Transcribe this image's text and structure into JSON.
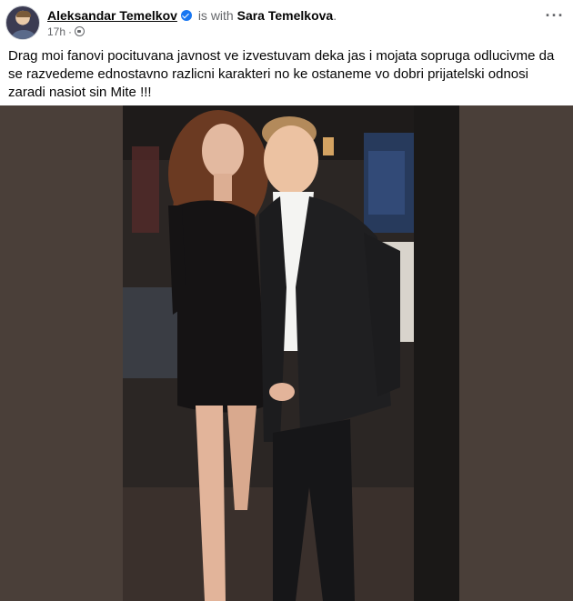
{
  "post": {
    "author": "Aleksandar Temelkov",
    "is_with": "is with",
    "tagged_user": "Sara Temelkova",
    "period": ".",
    "time": "17h",
    "dot": "·",
    "more_label": "···",
    "text": "Drag moi fanovi pocituvana javnost ve izvestuvam deka jas i mojata sopruga odlucivme da se razvedeme ednostavno razlicni karakteri no ke ostaneme vo dobri prijatelski odnosi  zaradi nasiot sin Mite !!!",
    "icons": [
      "verified-badge-icon",
      "globe-icon",
      "more-options-icon"
    ],
    "colors": {
      "verified": "#1877f2",
      "secondary_text": "#65676b",
      "photo_bg": "#4a3f39"
    }
  }
}
